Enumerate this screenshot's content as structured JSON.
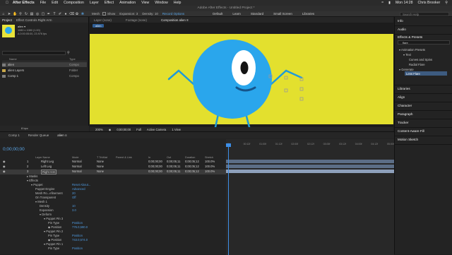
{
  "mac_menu": {
    "app": "After Effects",
    "items": [
      "File",
      "Edit",
      "Composition",
      "Layer",
      "Effect",
      "Animation",
      "View",
      "Window",
      "Help"
    ],
    "clock": "Mon 14:28",
    "user": "Chris Brooker"
  },
  "window_title": "Adobe After Effects - Untitled Project *",
  "toolbar": {
    "mesh_label": "Mesh",
    "show_label": "Show",
    "expansion_label": "Expansion: 3",
    "density_label": "Density: 10",
    "record_label": "Record Options",
    "workspaces": [
      "Default",
      "Learn",
      "Standard",
      "Small Screen",
      "Libraries"
    ],
    "search_placeholder": "Search Help"
  },
  "project": {
    "tabs": [
      "Project",
      "Effect Controls Right Arm"
    ],
    "item_name": "alien ▾",
    "item_size": "1080 x 1080 (1.00)",
    "item_duration": "Δ 0:00:05:00, 23.976 fps",
    "search_placeholder": "",
    "col_name": "Name",
    "col_type": "Type",
    "rows": [
      {
        "name": "alien",
        "type": "Compo"
      },
      {
        "name": "alien Layers",
        "type": "Folder"
      },
      {
        "name": "Comp 1",
        "type": "Compo"
      }
    ],
    "footer": "8 bpc"
  },
  "comp": {
    "tabs": [
      "Layer (none)",
      "Footage (none)",
      "Composition alien ≡"
    ],
    "breadcrumb": "alien",
    "zoom": "200%",
    "time": "0;00;00;00",
    "res": "Full",
    "camera": "Active Camera",
    "views": "1 View"
  },
  "right_panels": {
    "info": "Info",
    "audio": "Audio",
    "effects_presets": "Effects & Presets",
    "search_value": "flare",
    "tree": [
      {
        "label": "▾ Animation Presets",
        "indent": 0
      },
      {
        "label": "▾ Text",
        "indent": 1
      },
      {
        "label": "Curves and Spins",
        "indent": 2
      },
      {
        "label": "Radial Flare",
        "indent": 2
      },
      {
        "label": "▾ Generate",
        "indent": 0
      },
      {
        "label": "Lens Flare",
        "indent": 1
      }
    ],
    "libraries": "Libraries",
    "align": "Align",
    "character": "Character",
    "paragraph": "Paragraph",
    "tracker": "Tracker",
    "content_aware": "Content-Aware Fill",
    "motion_sketch": "Motion Sketch"
  },
  "timeline": {
    "tabs": [
      "Comp 1",
      "Render Queue",
      "alien ≡"
    ],
    "timecode": "0;00;00;00",
    "columns": [
      "Layer Name",
      "Mode",
      "T TrkMat",
      "Parent & Link",
      "In",
      "Out",
      "Duration",
      "Stretch"
    ],
    "layers": [
      {
        "num": "1",
        "name": "Right Leg",
        "mode": "Normal",
        "parent": "None",
        "in": "0;00;00;00",
        "out": "0;00;05;11",
        "dur": "0;00;05;12",
        "str": "100.0%"
      },
      {
        "num": "2",
        "name": "Left Leg",
        "mode": "Normal",
        "parent": "None",
        "in": "0;00;00;00",
        "out": "0;00;05;11",
        "dur": "0;00;05;12",
        "str": "100.0%"
      },
      {
        "num": "3",
        "name": "Right Arm",
        "mode": "Normal",
        "parent": "None",
        "in": "0;00;00;00",
        "out": "0;00;05;11",
        "dur": "0;00;05;12",
        "str": "100.0%"
      }
    ],
    "props": [
      {
        "label": "▸ Masks",
        "indent": 0,
        "value": ""
      },
      {
        "label": "▾ Effects",
        "indent": 0,
        "value": ""
      },
      {
        "label": "▾ Puppet",
        "indent": 1,
        "value": "Reset   About..."
      },
      {
        "label": "Puppet Engine",
        "indent": 2,
        "value": "Advanced"
      },
      {
        "label": "Mesh Ro...efinement",
        "indent": 2,
        "value": "20"
      },
      {
        "label": "On Transparent",
        "indent": 2,
        "value": "Off"
      },
      {
        "label": "▾ Mesh 1",
        "indent": 2,
        "value": ""
      },
      {
        "label": "Density",
        "indent": 3,
        "value": "10"
      },
      {
        "label": "Expansion",
        "indent": 3,
        "value": "3.0"
      },
      {
        "label": "▾ Deform",
        "indent": 3,
        "value": ""
      },
      {
        "label": "▾ Puppet Pin 3",
        "indent": 4,
        "value": ""
      },
      {
        "label": "Pin Type",
        "indent": 5,
        "value": "Position"
      },
      {
        "label": "◆ Position",
        "indent": 5,
        "value": "776.0,590.0"
      },
      {
        "label": "▾ Puppet Pin 2",
        "indent": 4,
        "value": ""
      },
      {
        "label": "Pin Type",
        "indent": 5,
        "value": "Position"
      },
      {
        "label": "◆ Position",
        "indent": 5,
        "value": "743.0,574.0"
      },
      {
        "label": "▾ Puppet Pin 1",
        "indent": 4,
        "value": ""
      },
      {
        "label": "Pin Type",
        "indent": 5,
        "value": "Position"
      }
    ],
    "ticks": [
      "0f",
      "00:12f",
      "01:00f",
      "01:12f",
      "02:00f",
      "02:12f",
      "03:00f",
      "03:12f",
      "04:00f",
      "04:12f",
      "05:00f"
    ]
  }
}
